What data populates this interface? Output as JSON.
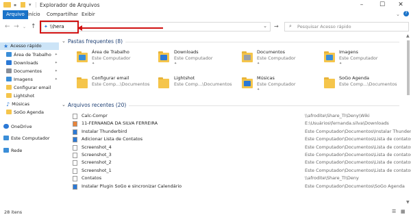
{
  "window": {
    "title": "Explorador de Arquivos"
  },
  "ribbon": {
    "tabs": [
      "Arquivo",
      "Início",
      "Compartilhar",
      "Exibir"
    ]
  },
  "address": {
    "value": "\\\\hera",
    "search_placeholder": "Pesquisar Acesso rápido"
  },
  "sidebar": {
    "items": [
      {
        "label": "Acesso rápido",
        "icon": "star-icon",
        "color": "#2b79d6"
      },
      {
        "label": "Área de Trabalho",
        "icon": "desktop-icon",
        "color": "#3b8ed8"
      },
      {
        "label": "Downloads",
        "icon": "download-icon",
        "color": "#2b79d6"
      },
      {
        "label": "Documentos",
        "icon": "documents-icon",
        "color": "#8a8f99"
      },
      {
        "label": "Imagens",
        "icon": "pictures-icon",
        "color": "#3b8ed8"
      },
      {
        "label": "Configurar email",
        "icon": "folder-icon",
        "color": "#f5c54b"
      },
      {
        "label": "Lightshot",
        "icon": "folder-icon",
        "color": "#f5c54b"
      },
      {
        "label": "Músicas",
        "icon": "music-icon",
        "color": "#2b79d6"
      },
      {
        "label": "SoGo Agenda",
        "icon": "folder-icon",
        "color": "#f5c54b"
      },
      {
        "label": "OneDrive",
        "icon": "cloud-icon",
        "color": "#2b79d6"
      },
      {
        "label": "Este Computador",
        "icon": "computer-icon",
        "color": "#3b8ed8"
      },
      {
        "label": "Rede",
        "icon": "network-icon",
        "color": "#3b8ed8"
      }
    ]
  },
  "frequent": {
    "heading": "Pastas frequentes (8)",
    "tiles": [
      {
        "name": "Área de Trabalho",
        "sub": "Este Computador",
        "color": "#3b8ed8"
      },
      {
        "name": "Downloads",
        "sub": "Este Computador",
        "color": "#2b79d6"
      },
      {
        "name": "Documentos",
        "sub": "Este Computador",
        "color": "#9aa0a8"
      },
      {
        "name": "Imagens",
        "sub": "Este Computador",
        "color": "#3b8ed8"
      },
      {
        "name": "Configurar email",
        "sub": "Este Comp...\\Documentos",
        "color": ""
      },
      {
        "name": "Lightshot",
        "sub": "Este Comp...\\Documentos",
        "color": ""
      },
      {
        "name": "Músicas",
        "sub": "Este Computador",
        "color": "#2b79d6"
      },
      {
        "name": "SoGo Agenda",
        "sub": "Este Comp...\\Documentos",
        "color": ""
      }
    ]
  },
  "recent": {
    "heading": "Arquivos recentes (20)",
    "rows": [
      {
        "name": "Calc-Compr",
        "path": "\\\\afrodite\\Share_TI\\Deny\\Wiki"
      },
      {
        "name": "11-FERNANDA DA SILVA FERREIRA",
        "path": "E:\\Usuários\\fernanda.silva\\Downloads"
      },
      {
        "name": "Instalar Thunderbird",
        "path": "Este Computador\\Documentos\\Instalar Thunderbird"
      },
      {
        "name": "Adicionar Lista de Contatos",
        "path": "Este Computador\\Documentos\\Lista de contatos"
      },
      {
        "name": "Screenshot_4",
        "path": "Este Computador\\Documentos\\Lista de contatos"
      },
      {
        "name": "Screenshot_3",
        "path": "Este Computador\\Documentos\\Lista de contatos"
      },
      {
        "name": "Screenshot_2",
        "path": "Este Computador\\Documentos\\Lista de contatos"
      },
      {
        "name": "Screenshot_1",
        "path": "Este Computador\\Documentos\\Lista de contatos"
      },
      {
        "name": "Contatos",
        "path": "\\\\afrodite\\Share_TI\\Deny"
      },
      {
        "name": "Instalar Plugin SoGo e sincronizar Calendário",
        "path": "Este Computador\\Documentos\\SoGo Agenda"
      }
    ]
  },
  "status": {
    "count": "28 itens"
  },
  "colors": {
    "accent": "#1a73c9",
    "annotation": "#d01010",
    "heading": "#1e3f73"
  }
}
